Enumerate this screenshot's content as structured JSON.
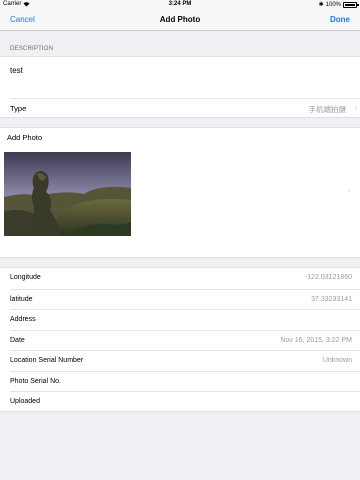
{
  "status_bar": {
    "carrier": "Carrier",
    "time": "3:24 PM",
    "battery": "100%"
  },
  "nav": {
    "cancel": "Cancel",
    "title": "Add Photo",
    "done": "Done"
  },
  "description_section": {
    "header": "DESCRIPTION",
    "value": "test"
  },
  "type_row": {
    "label": "Type",
    "value": "手机端拍摄"
  },
  "photo_section": {
    "label": "Add Photo"
  },
  "details": [
    {
      "label": "Longitude",
      "value": "-122.03121860"
    },
    {
      "label": "latitude",
      "value": "37.33233141"
    },
    {
      "label": "Address",
      "value": ""
    },
    {
      "label": "Date",
      "value": "Nov 16, 2015, 3:22 PM"
    },
    {
      "label": "Location Serial Number",
      "value": "Unknown"
    },
    {
      "label": "Photo Serial No.",
      "value": ""
    },
    {
      "label": "Uploaded",
      "value": ""
    }
  ],
  "colors": {
    "accent": "#1a7ae6",
    "background": "#efeff4",
    "secondary_text": "#9b9b9b"
  },
  "icons": {
    "signal": "wifi-icon",
    "battery": "battery-icon",
    "chevron": "chevron-right-icon"
  }
}
